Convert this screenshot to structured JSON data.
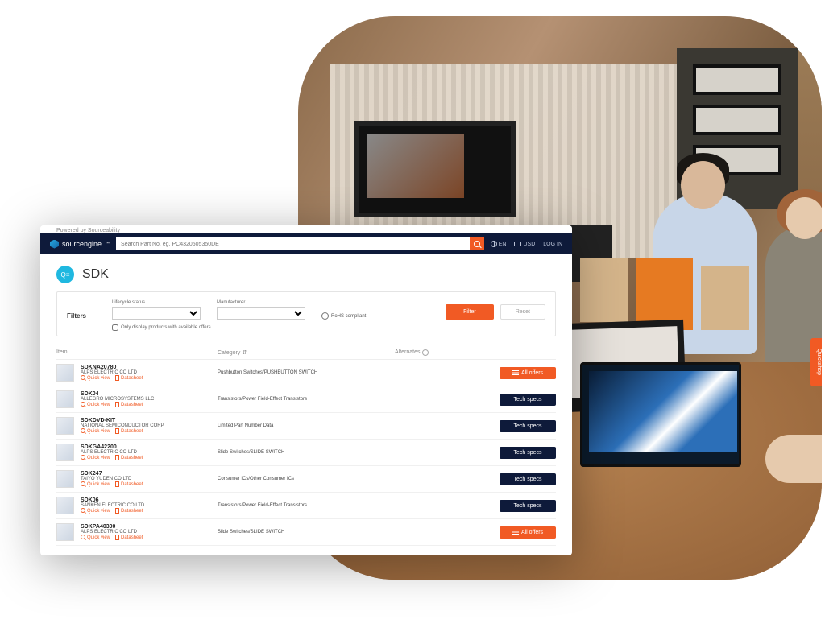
{
  "powered_by": "Powered by Sourceability",
  "brand": "sourcengine",
  "search": {
    "placeholder": "Search Part No. eg. PC4320505350DE"
  },
  "top_links": {
    "lang": "EN",
    "currency": "USD",
    "login": "LOG IN"
  },
  "page": {
    "icon_text": "Q≡",
    "title": "SDK"
  },
  "filters": {
    "label": "Filters",
    "lifecycle_label": "Lifecycle status",
    "manufacturer_label": "Manufacturer",
    "rohs_label": "RoHS compliant",
    "filter_btn": "Filter",
    "reset_btn": "Reset",
    "only_available": "Only display products with available offers."
  },
  "columns": {
    "item": "Item",
    "category": "Category",
    "alternates": "Alternates"
  },
  "quick_view": "Quick view",
  "datasheet": "Datasheet",
  "btn_all_offers": "All offers",
  "btn_tech_specs": "Tech specs",
  "rows": [
    {
      "part": "SDKNA20780",
      "mfr": "ALPS ELECTRIC CO LTD",
      "category": "Pushbutton Switches/PUSHBUTTON SWITCH",
      "action": "offers"
    },
    {
      "part": "SDK04",
      "mfr": "ALLEGRO MICROSYSTEMS LLC",
      "category": "Transistors/Power Field-Effect Transistors",
      "action": "specs"
    },
    {
      "part": "SDKDVD-KIT",
      "mfr": "NATIONAL SEMICONDUCTOR CORP",
      "category": "Limited Part Number Data",
      "action": "specs"
    },
    {
      "part": "SDKGA42200",
      "mfr": "ALPS ELECTRIC CO LTD",
      "category": "Slide Switches/SLIDE SWITCH",
      "action": "specs"
    },
    {
      "part": "SDK247",
      "mfr": "TAIYO YUDEN CO LTD",
      "category": "Consumer ICs/Other Consumer ICs",
      "action": "specs"
    },
    {
      "part": "SDK06",
      "mfr": "SANKEN ELECTRIC CO LTD",
      "category": "Transistors/Power Field-Effect Transistors",
      "action": "specs"
    },
    {
      "part": "SDKPA40300",
      "mfr": "ALPS ELECTRIC CO LTD",
      "category": "Slide Switches/SLIDE SWITCH",
      "action": "offers"
    }
  ],
  "side_tab": "Quickshop"
}
